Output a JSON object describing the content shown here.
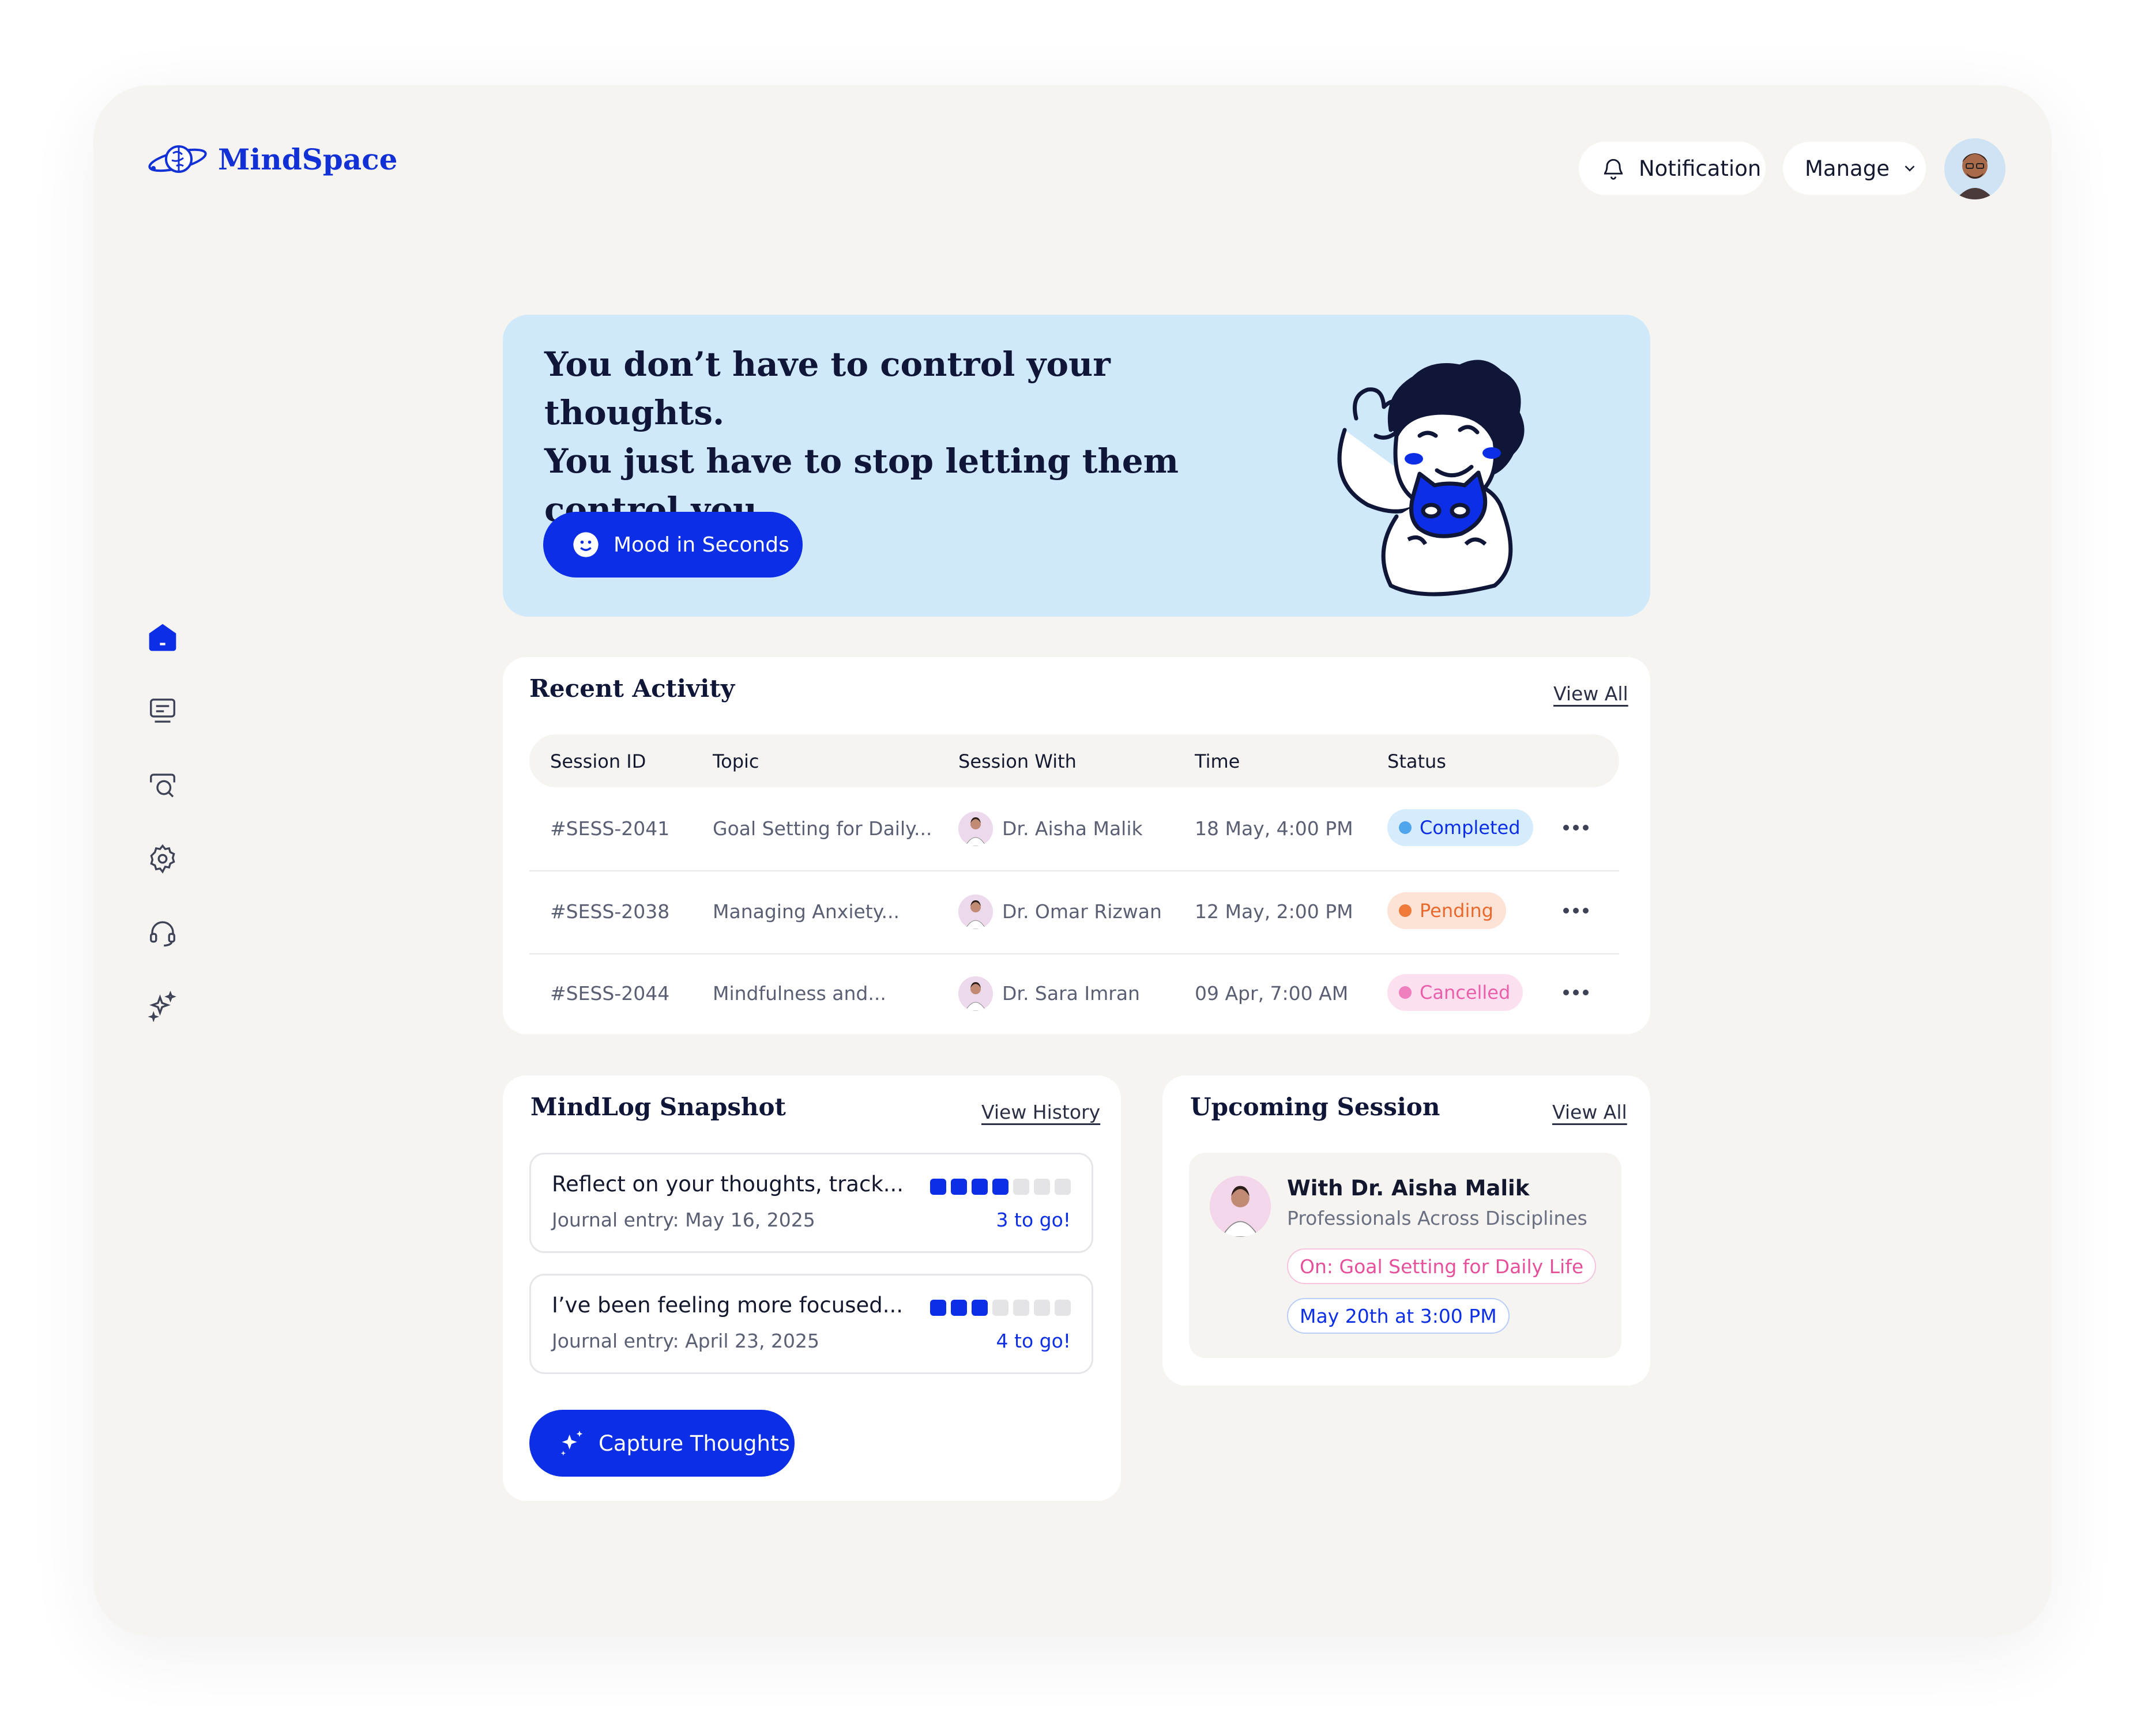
{
  "app": {
    "name": "MindSpace",
    "brand_color": "#1130d6",
    "accent_color": "#0b2ee6"
  },
  "header": {
    "notification_label": "Notification",
    "manage_label": "Manage",
    "icons": [
      "bell-icon",
      "chevron-down-icon",
      "user-avatar"
    ]
  },
  "sidebar": {
    "items": [
      {
        "icon": "home-icon",
        "active": true
      },
      {
        "icon": "journal-icon",
        "active": false
      },
      {
        "icon": "search-chat-icon",
        "active": false
      },
      {
        "icon": "gear-icon",
        "active": false
      },
      {
        "icon": "headset-icon",
        "active": false
      },
      {
        "icon": "sparkles-icon",
        "active": false
      }
    ]
  },
  "hero": {
    "quote_line1": "You don’t have to control your thoughts.",
    "quote_line2": "You just have to stop letting them",
    "quote_line3": "control you.",
    "button_label": "Mood in Seconds",
    "background_color": "#cfe9fb"
  },
  "recent_activity": {
    "title": "Recent Activity",
    "view_all": "View All",
    "columns": [
      "Session ID",
      "Topic",
      "Session With",
      "Time",
      "Status"
    ],
    "rows": [
      {
        "id": "#SESS-2041",
        "topic": "Goal Setting for Daily...",
        "with": "Dr. Aisha Malik",
        "time": "18 May, 4:00 PM",
        "status": "Completed"
      },
      {
        "id": "#SESS-2038",
        "topic": "Managing Anxiety...",
        "with": "Dr. Omar Rizwan",
        "time": "12 May, 2:00 PM",
        "status": "Pending"
      },
      {
        "id": "#SESS-2044",
        "topic": "Mindfulness and...",
        "with": "Dr. Sara Imran",
        "time": "09 Apr, 7:00 AM",
        "status": "Cancelled"
      }
    ],
    "status_colors": {
      "Completed": {
        "bg": "#d4ecfb",
        "dot": "#4fa6ec",
        "text": "#0b2ee6"
      },
      "Pending": {
        "bg": "#fde3d6",
        "dot": "#f07a3a",
        "text": "#e8692b"
      },
      "Cancelled": {
        "bg": "#fde0ef",
        "dot": "#f07fbf",
        "text": "#ea5fa9"
      }
    }
  },
  "mindlog": {
    "title": "MindLog Snapshot",
    "view_history": "View History",
    "entries": [
      {
        "text": "Reflect on your thoughts, track...",
        "date": "Journal entry: May 16, 2025",
        "progress_done": 4,
        "progress_total": 7,
        "remaining": "3 to go!"
      },
      {
        "text": "I’ve been feeling more focused...",
        "date": "Journal entry: April 23, 2025",
        "progress_done": 3,
        "progress_total": 7,
        "remaining": "4 to go!"
      }
    ],
    "button_label": "Capture Thoughts"
  },
  "upcoming": {
    "title": "Upcoming Session",
    "view_all": "View All",
    "doctor": "With Dr. Aisha Malik",
    "role": "Professionals Across Disciplines",
    "topic": "On: Goal Setting for Daily Life",
    "datetime": "May 20th at 3:00 PM"
  }
}
